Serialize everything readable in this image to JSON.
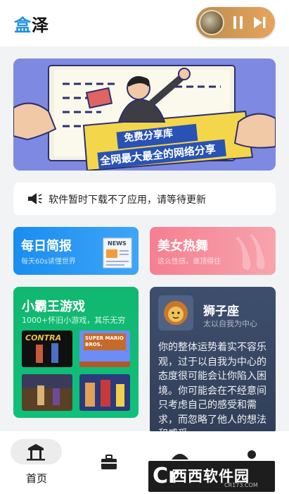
{
  "app": {
    "brand_char1": "盒",
    "brand_char2": "泽"
  },
  "music": {
    "state": "playing"
  },
  "banner": {
    "line1": "免费分享库",
    "line2": "全网最大最全的网络分享"
  },
  "notice": {
    "text": "软件暂时下载不了应用，请等待更新"
  },
  "cards": {
    "daily": {
      "title": "每日简报",
      "subtitle": "每天60s读懂世界",
      "news_label": "NEWS"
    },
    "dance": {
      "title": "美女热舞",
      "subtitle": "这么性感，谁顶得住"
    },
    "games": {
      "title": "小霸王游戏",
      "subtitle": "1000+怀旧小游戏，其乐无穷",
      "tiles": [
        {
          "name": "CONTRA"
        },
        {
          "name": "SUPER MARIO BROS."
        },
        {
          "name": ""
        },
        {
          "name": ""
        }
      ]
    },
    "horoscope": {
      "sign": "狮子座",
      "tagline": "太以自我为中心",
      "text": "你的整体运势着实不容乐观，过于以自我为中心的态度很可能会让你陷入困境。你可能会在不经意间只考虑自己的感受和需求，而忽略了他人的想法和感受。"
    }
  },
  "bottom_nav": {
    "items": [
      {
        "label": "首页",
        "active": true
      },
      {
        "label": ""
      },
      {
        "label": ""
      },
      {
        "label": ""
      }
    ]
  },
  "watermark": {
    "text": "西西软件园",
    "url": "CR173.COM"
  },
  "colors": {
    "accent": "#1e8fe1",
    "games": "#11b770",
    "daily": "#1a8df0",
    "dance": "#f57f91",
    "horoscope": "#3e4f6e"
  }
}
